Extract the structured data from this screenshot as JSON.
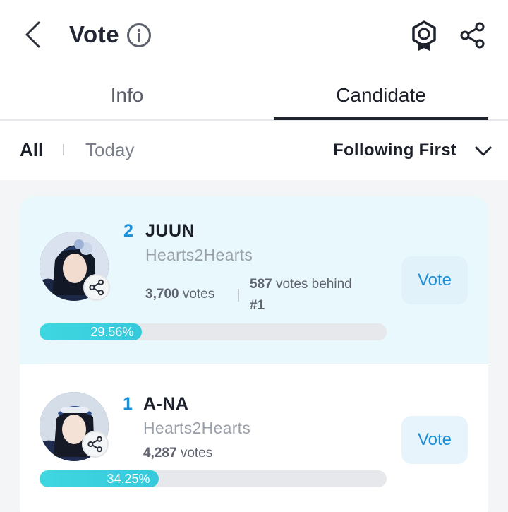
{
  "header": {
    "title": "Vote"
  },
  "tabs": [
    {
      "label": "Info"
    },
    {
      "label": "Candidate"
    }
  ],
  "filter": {
    "all": "All",
    "today": "Today",
    "sort": "Following First"
  },
  "candidates": [
    {
      "rank": "2",
      "name": "JUUN",
      "group": "Hearts2Hearts",
      "votes_count": "3,700",
      "votes_word": "votes",
      "behind_count": "587",
      "behind_text": "votes behind",
      "behind_target": "#1",
      "percent_label": "29.56%",
      "percent": 29.56,
      "vote_label": "Vote"
    },
    {
      "rank": "1",
      "name": "A-NA",
      "group": "Hearts2Hearts",
      "votes_count": "4,287",
      "votes_word": "votes",
      "percent_label": "34.25%",
      "percent": 34.25,
      "vote_label": "Vote"
    }
  ],
  "colors": {
    "accent": "#1d8fd6",
    "bar": "#3fd7e0",
    "highlight_row": "#e9f8fc"
  }
}
